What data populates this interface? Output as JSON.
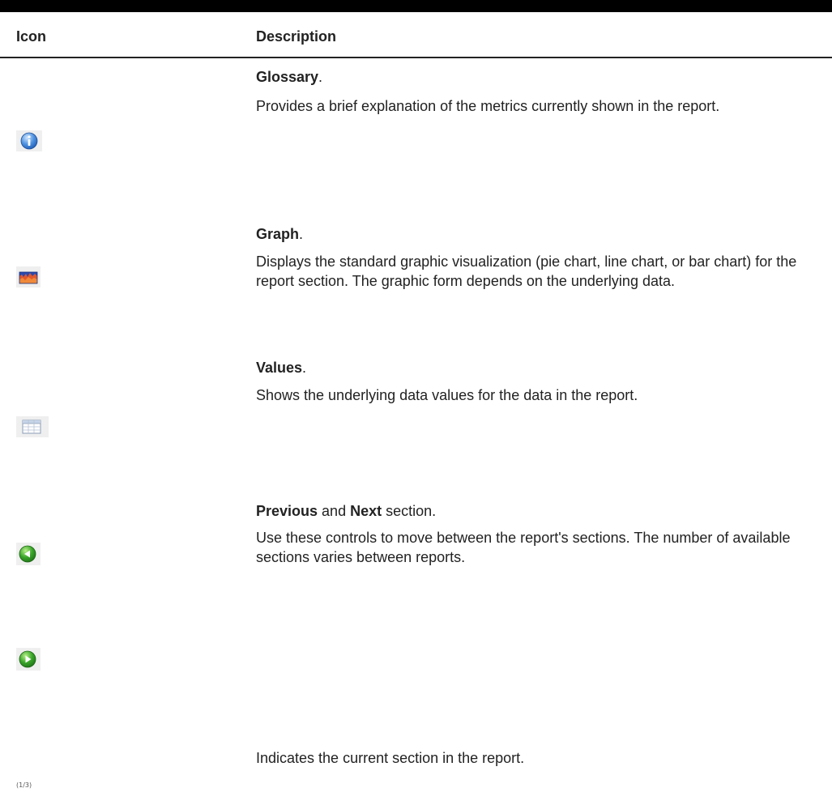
{
  "header": {
    "icon_col": "Icon",
    "description_col": "Description"
  },
  "rows": [
    {
      "icon": "info-icon",
      "title_bold": "Glossary",
      "title_suffix": ".",
      "description": "Provides a brief explanation of the metrics currently shown in the report."
    },
    {
      "icon": "graph-icon",
      "title_bold": "Graph",
      "title_suffix": ".",
      "description": "Displays the standard graphic visualization (pie chart, line chart, or bar chart) for the report section. The graphic form depends on the underlying data."
    },
    {
      "icon": "table-icon",
      "title_bold": "Values",
      "title_suffix": ".",
      "description": "Shows the underlying data values for the data in the report."
    },
    {
      "icon": "previous-icon",
      "title_bold": "Previous",
      "title_middle": " and ",
      "title_bold2": "Next",
      "title_suffix": " section.",
      "description": "Use these controls to move between the report's sections. The number of available sections varies between reports."
    },
    {
      "icon": "next-icon"
    },
    {
      "icon": "section-indicator",
      "description": "Indicates the current section in the report.",
      "indicator_text": "(1/3)"
    }
  ]
}
